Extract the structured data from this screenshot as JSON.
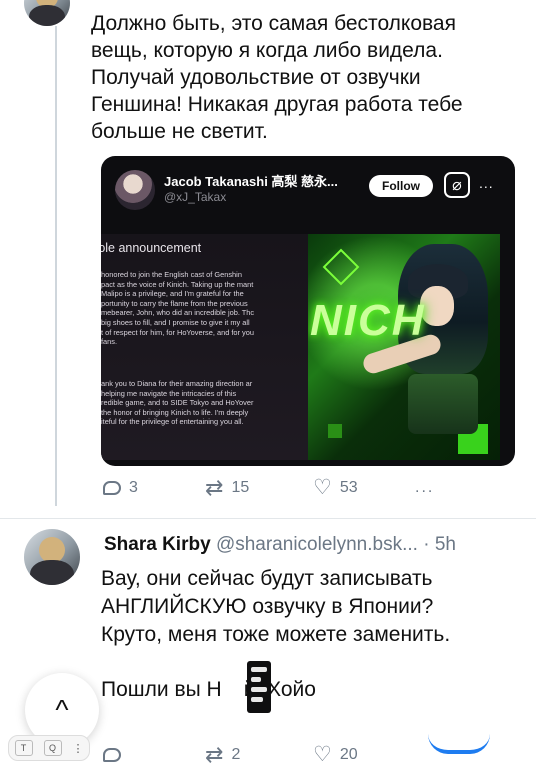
{
  "post": {
    "text": "Должно быть, это самая бестолковая вещь, которую я когда либо видела. Получай удовольствие от озвучки Геншина! Никакая другая работа тебе больше не светит.",
    "embed": {
      "author_name": "Jacob Takanashi 高梨 慈永...",
      "author_handle": "@xJ_Takax",
      "follow_label": "Follow",
      "more_label": "...",
      "doc_title": "ɔle announcement",
      "doc_lines_1": [
        "honored to join the English cast of Genshin",
        "pact as the voice of Kinich. Taking up the mant",
        "Malipo is a privilege, and I'm grateful for the",
        "portunity to carry the flame from the previous",
        "mebearer, John, who did an incredible job. Thc",
        "big shoes to fill, and I promise to give it my all",
        "t of respect for him, for HoYoverse, and for you",
        "fans."
      ],
      "doc_lines_2": [
        "ank you to Diana for their amazing direction ar",
        "helping me navigate the intricacies of this",
        "redible game, and to SIDE Tokyo and HoYover",
        "the honor of bringing Kinich to life. I'm deeply",
        "iteful for the privilege of entertaining you all."
      ],
      "art_title": "NICH"
    },
    "actions": {
      "replies": "3",
      "reposts": "15",
      "likes": "53",
      "more": "..."
    }
  },
  "reply": {
    "author_name": "Shara Kirby",
    "author_handle": "@sharanicolelynn.bsk...",
    "time": "· 5h",
    "lines": [
      "Вау, они сейчас будут записывать",
      "АНГЛИЙСКУЮ озвучку в Японии?",
      "Круто, меня тоже можете заменить."
    ],
    "last_line_before": "Пошли вы Н",
    "last_line_after": "й, Хойо",
    "actions": {
      "replies": "",
      "reposts": "2",
      "likes": "20"
    }
  },
  "ui": {
    "scroll_up_label": "^",
    "tray_items": [
      "T",
      "Q",
      "⋮"
    ]
  }
}
